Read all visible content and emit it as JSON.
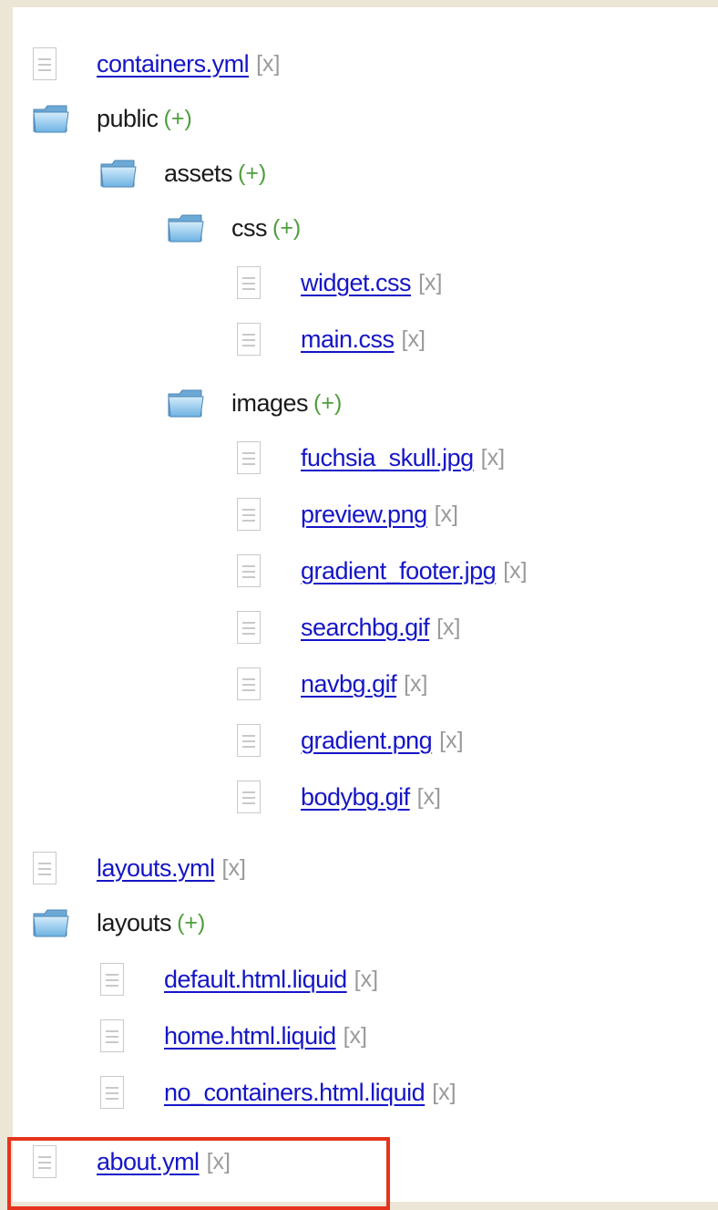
{
  "tree": {
    "delete_label": "[x]",
    "add_label": "(+)",
    "items": [
      {
        "type": "file",
        "name": "containers.yml"
      },
      {
        "type": "folder",
        "name": "public"
      },
      {
        "type": "folder",
        "name": "assets"
      },
      {
        "type": "folder",
        "name": "css"
      },
      {
        "type": "file",
        "name": "widget.css"
      },
      {
        "type": "file",
        "name": "main.css"
      },
      {
        "type": "folder",
        "name": "images"
      },
      {
        "type": "file",
        "name": "fuchsia_skull.jpg"
      },
      {
        "type": "file",
        "name": "preview.png"
      },
      {
        "type": "file",
        "name": "gradient_footer.jpg"
      },
      {
        "type": "file",
        "name": "searchbg.gif"
      },
      {
        "type": "file",
        "name": "navbg.gif"
      },
      {
        "type": "file",
        "name": "gradient.png"
      },
      {
        "type": "file",
        "name": "bodybg.gif"
      },
      {
        "type": "file",
        "name": "layouts.yml"
      },
      {
        "type": "folder",
        "name": "layouts"
      },
      {
        "type": "file",
        "name": "default.html.liquid"
      },
      {
        "type": "file",
        "name": "home.html.liquid"
      },
      {
        "type": "file",
        "name": "no_containers.html.liquid"
      },
      {
        "type": "file",
        "name": "about.yml"
      }
    ]
  },
  "colors": {
    "link": "#1515c8",
    "add": "#4e9e3c",
    "delete": "#9a9a9a",
    "highlight": "#e5331d",
    "background": "#ece6d6"
  }
}
